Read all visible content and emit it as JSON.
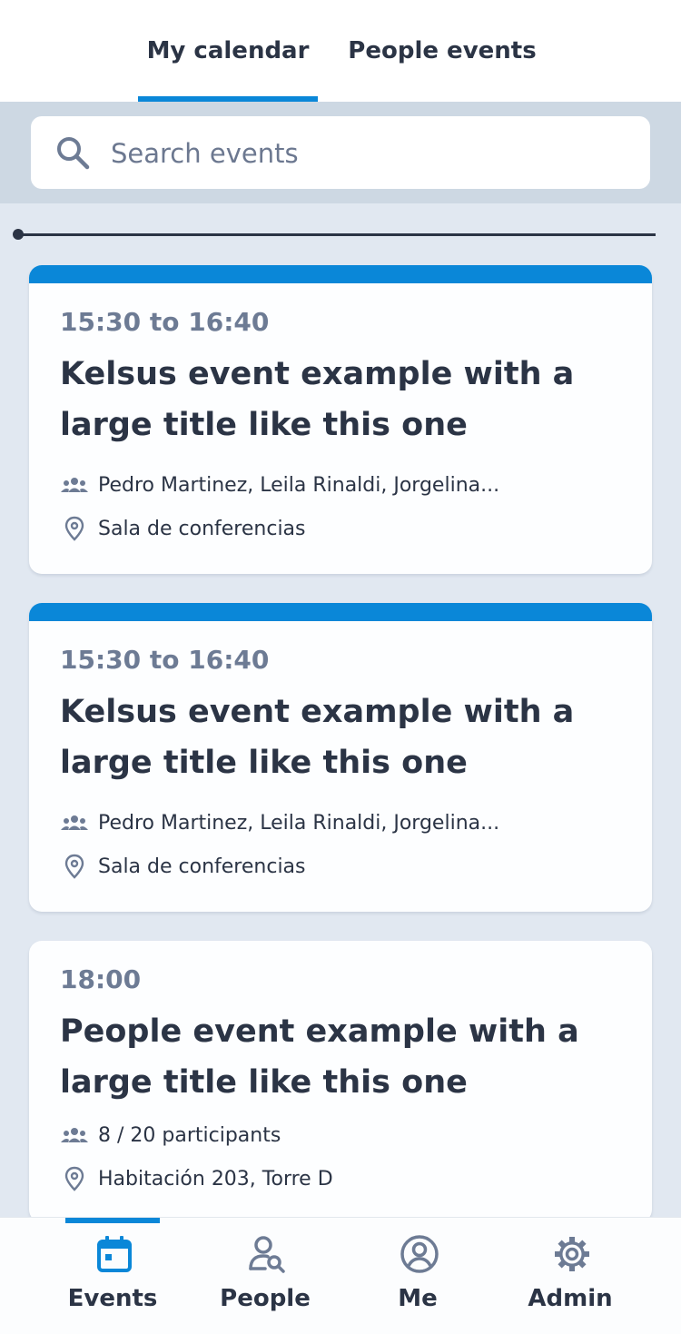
{
  "top_tabs": [
    {
      "label": "My calendar",
      "active": true
    },
    {
      "label": "People events",
      "active": false
    }
  ],
  "search": {
    "placeholder": "Search events"
  },
  "events": [
    {
      "time": "15:30 to 16:40",
      "title_line1": "Kelsus event example with a",
      "title_line2": "large title like this one",
      "attendees": "Pedro Martinez, Leila Rinaldi, Jorgelina...",
      "location": "Sala de conferencias",
      "has_accent": true
    },
    {
      "time": "15:30 to 16:40",
      "title_line1": "Kelsus event example with a",
      "title_line2": "large title like this one",
      "attendees": "Pedro Martinez, Leila Rinaldi, Jorgelina...",
      "location": "Sala de conferencias",
      "has_accent": true
    },
    {
      "time": "18:00",
      "title_line1": "People event example with a",
      "title_line2": "large title like this one",
      "attendees": "8 / 20 participants",
      "location": "Habitación 203, Torre D",
      "has_accent": false
    }
  ],
  "bottom_nav": [
    {
      "label": "Events",
      "icon": "calendar-icon",
      "active": true
    },
    {
      "label": "People",
      "icon": "person-search-icon",
      "active": false
    },
    {
      "label": "Me",
      "icon": "account-circle-icon",
      "active": false
    },
    {
      "label": "Admin",
      "icon": "gear-icon",
      "active": false
    }
  ],
  "colors": {
    "accent": "#0a87d8",
    "text": "#2b3445",
    "muted": "#6d7b94",
    "background": "#e1e8f1"
  }
}
